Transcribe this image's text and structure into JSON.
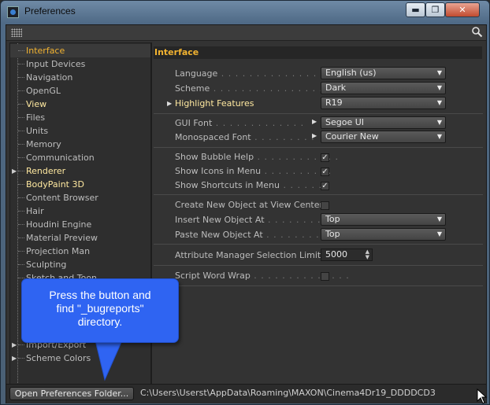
{
  "window": {
    "title": "Preferences",
    "controls": {
      "minimize": "▬",
      "maximize": "❐",
      "close": "✕"
    }
  },
  "sidebar": {
    "items": [
      {
        "label": "Interface",
        "state": "selected"
      },
      {
        "label": "Input Devices",
        "state": "normal"
      },
      {
        "label": "Navigation",
        "state": "normal"
      },
      {
        "label": "OpenGL",
        "state": "normal"
      },
      {
        "label": "View",
        "state": "highlight"
      },
      {
        "label": "Files",
        "state": "normal"
      },
      {
        "label": "Units",
        "state": "normal"
      },
      {
        "label": "Memory",
        "state": "normal"
      },
      {
        "label": "Communication",
        "state": "normal"
      },
      {
        "label": "Renderer",
        "state": "highlight",
        "expandable": true
      },
      {
        "label": "BodyPaint 3D",
        "state": "highlight"
      },
      {
        "label": "Content Browser",
        "state": "normal"
      },
      {
        "label": "Hair",
        "state": "normal"
      },
      {
        "label": "Houdini Engine",
        "state": "normal"
      },
      {
        "label": "Material Preview",
        "state": "normal"
      },
      {
        "label": "Projection Man",
        "state": "normal"
      },
      {
        "label": "Sculpting",
        "state": "normal"
      },
      {
        "label": "Sketch and Toon",
        "state": "normal"
      },
      {
        "label": "Import/Export",
        "state": "normal",
        "expandable": true
      },
      {
        "label": "Scheme Colors",
        "state": "normal",
        "expandable": true
      }
    ]
  },
  "panel": {
    "heading": "Interface",
    "language": {
      "label": "Language",
      "dots": " . . . . . . . . . . . . . . .",
      "value": "English (us)"
    },
    "scheme": {
      "label": "Scheme",
      "dots": " . . . . . . . . . . . . . . . .",
      "value": "Dark"
    },
    "highlight_features": {
      "label": "Highlight Features",
      "value": "R19"
    },
    "gui_font": {
      "label": "GUI Font",
      "dots": " . . . . . . . . . . . . .",
      "value": "Segoe UI"
    },
    "mono_font": {
      "label": "Monospaced Font",
      "dots": " . . . . . . . . .",
      "value": "Courier New"
    },
    "show_bubble_help": {
      "label": "Show Bubble Help",
      "dots": " . . . . . . . . . . . .",
      "checked": true
    },
    "show_icons_menu": {
      "label": "Show Icons in Menu",
      "dots": " . . . . . . . . . .",
      "checked": true
    },
    "show_shortcuts_menu": {
      "label": "Show Shortcuts in Menu",
      "dots": " . . . . . .",
      "checked": true
    },
    "create_at_view_center": {
      "label": "Create New Object at View Center",
      "checked": false
    },
    "insert_new_object": {
      "label": "Insert New Object At",
      "dots": " . . . . . . . . . .",
      "value": "Top"
    },
    "paste_new_object": {
      "label": "Paste New Object At",
      "dots": " . . . . . . . . . . .",
      "value": "Top"
    },
    "attr_selection_limit": {
      "label": "Attribute Manager Selection Limit",
      "value": "5000"
    },
    "script_word_wrap": {
      "label": "Script Word Wrap",
      "dots": " . . . . . . . . . . . . . .",
      "checked": false
    }
  },
  "footer": {
    "open_button": "Open Preferences Folder...",
    "path": "C:\\Users\\Userst\\AppData\\Roaming\\MAXON\\Cinema4Dr19_DDDDCD3"
  },
  "callout": {
    "line1": "Press the button and",
    "line2": "find \"_bugreports\"",
    "line3": "directory.",
    "color": "#2f64f2"
  },
  "colors": {
    "accent": "#f2b331",
    "highlight_text": "#ffe9a0",
    "background": "#333333"
  }
}
